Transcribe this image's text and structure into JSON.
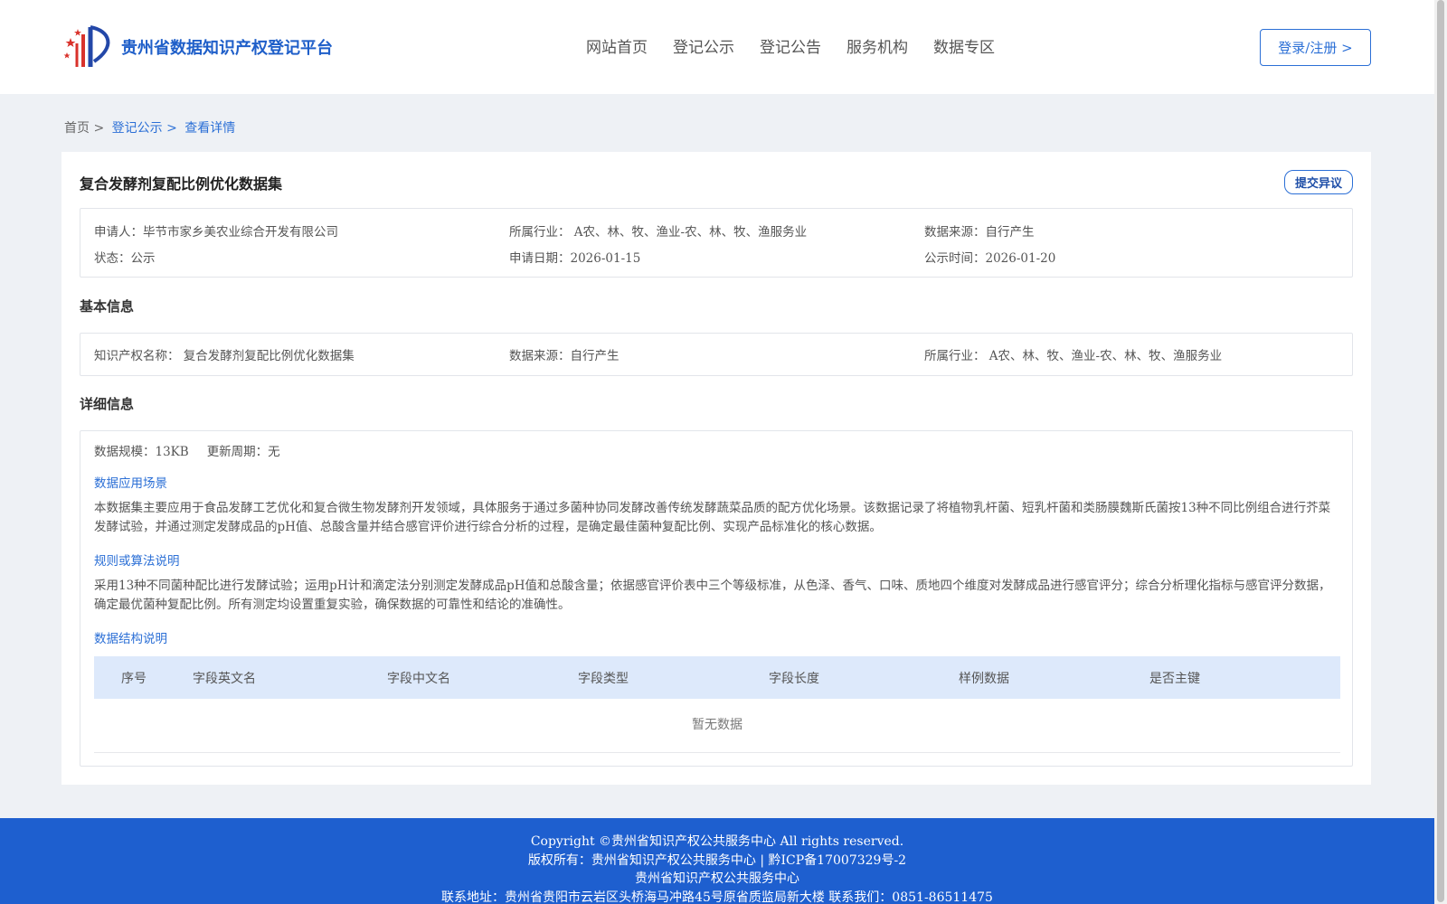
{
  "header": {
    "site_title": "贵州省数据知识产权登记平台",
    "nav": [
      "网站首页",
      "登记公示",
      "登记公告",
      "服务机构",
      "数据专区"
    ],
    "login_label": "登录/注册 >"
  },
  "breadcrumb": {
    "home": "首页 >",
    "publicity": "登记公示 >",
    "current": "查看详情"
  },
  "detail": {
    "title": "复合发酵剂复配比例优化数据集",
    "objection_label": "提交异议",
    "summary": {
      "applicant": "申请人：毕节市家乡美农业综合开发有限公司",
      "industry": "所属行业： A农、林、牧、渔业-农、林、牧、渔服务业",
      "source": "数据来源：自行产生",
      "status": "状态：公示",
      "apply_date": "申请日期：2026-01-15",
      "publicity_time": "公示时间：2026-01-20"
    },
    "basic_title": "基本信息",
    "basic": {
      "ip_name": "知识产权名称： 复合发酵剂复配比例优化数据集",
      "source": "数据来源：自行产生",
      "industry": "所属行业： A农、林、牧、渔业-农、林、牧、渔服务业"
    },
    "detail_title": "详细信息",
    "scale": "数据规模：13KB",
    "update_cycle": "更新周期：无",
    "scene_title": "数据应用场景",
    "scene_text": "本数据集主要应用于食品发酵工艺优化和复合微生物发酵剂开发领域，具体服务于通过多菌种协同发酵改善传统发酵蔬菜品质的配方优化场景。该数据记录了将植物乳杆菌、短乳杆菌和类肠膜魏斯氏菌按13种不同比例组合进行芥菜发酵试验，并通过测定发酵成品的pH值、总酸含量并结合感官评价进行综合分析的过程，是确定最佳菌种复配比例、实现产品标准化的核心数据。",
    "rule_title": "规则或算法说明",
    "rule_text": "采用13种不同菌种配比进行发酵试验；运用pH计和滴定法分别测定发酵成品pH值和总酸含量；依据感官评价表中三个等级标准，从色泽、香气、口味、质地四个维度对发酵成品进行感官评分；综合分析理化指标与感官评分数据，确定最优菌种复配比例。所有测定均设置重复实验，确保数据的可靠性和结论的准确性。",
    "structure_title": "数据结构说明",
    "table_headers": [
      "序号",
      "字段英文名",
      "字段中文名",
      "字段类型",
      "字段长度",
      "样例数据",
      "是否主键"
    ],
    "empty_text": "暂无数据"
  },
  "footer": {
    "copyright": "Copyright ©贵州省知识产权公共服务中心 All rights reserved.",
    "owner": "版权所有：贵州省知识产权公共服务中心 | 黔ICP备17007329号-2",
    "org": "贵州省知识产权公共服务中心",
    "address": "联系地址：贵州省贵阳市云岩区头桥海马冲路45号原省质监局新大楼 联系我们：0851-86511475"
  },
  "colors": {
    "brand": "#1f5fc9",
    "footer_bg": "#1e5fcf",
    "table_head": "#dde9fb"
  }
}
